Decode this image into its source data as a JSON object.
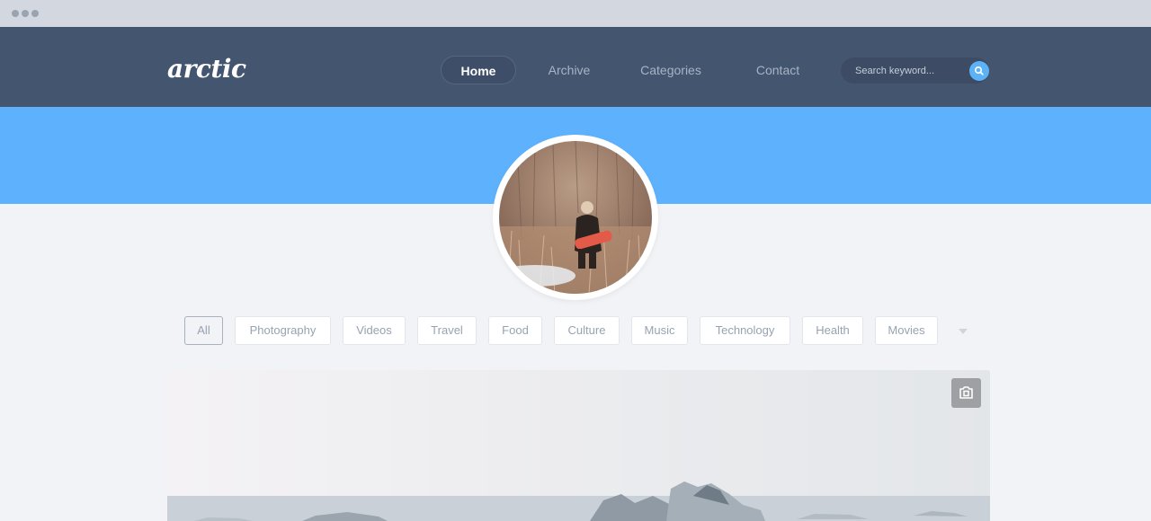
{
  "app": {
    "logo": "arctic"
  },
  "nav": {
    "items": [
      {
        "label": "Home",
        "active": true
      },
      {
        "label": "Archive",
        "active": false
      },
      {
        "label": "Categories",
        "active": false
      },
      {
        "label": "Contact",
        "active": false
      }
    ]
  },
  "search": {
    "placeholder": "Search keyword...",
    "icon": "search-icon"
  },
  "filters": {
    "items": [
      {
        "label": "All",
        "active": true
      },
      {
        "label": "Photography",
        "active": false
      },
      {
        "label": "Videos",
        "active": false
      },
      {
        "label": "Travel",
        "active": false
      },
      {
        "label": "Food",
        "active": false
      },
      {
        "label": "Culture",
        "active": false
      },
      {
        "label": "Music",
        "active": false
      },
      {
        "label": "Technology",
        "active": false
      },
      {
        "label": "Health",
        "active": false
      },
      {
        "label": "Movies",
        "active": false
      }
    ],
    "more_icon": "caret-down-icon"
  },
  "hero": {
    "badge_icon": "camera-icon"
  },
  "colors": {
    "navbar": "#44556f",
    "banner": "#5eb2fd",
    "accent": "#5db2f7",
    "background": "#f1f3f6"
  }
}
